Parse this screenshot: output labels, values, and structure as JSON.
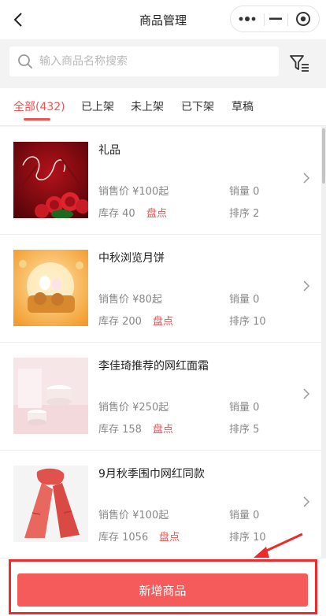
{
  "header": {
    "title": "商品管理"
  },
  "capsule": {
    "more_icon": "more-dots-icon",
    "minimize_icon": "minimize-icon",
    "close_icon": "target-circle-icon"
  },
  "search": {
    "placeholder": "输入商品名称搜索",
    "value": ""
  },
  "tabs": [
    {
      "label": "全部(432)",
      "active": true
    },
    {
      "label": "已上架",
      "active": false
    },
    {
      "label": "未上架",
      "active": false
    },
    {
      "label": "已下架",
      "active": false
    },
    {
      "label": "草稿",
      "active": false
    }
  ],
  "products": [
    {
      "name": "礼品",
      "price": "销售价 ¥100起",
      "stock": "库存 40",
      "action": "盘点",
      "sales": "销量 0",
      "sort": "排序 2"
    },
    {
      "name": "中秋浏览月饼",
      "price": "销售价 ¥80起",
      "stock": "库存 200",
      "action": "盘点",
      "sales": "销量 0",
      "sort": "排序 10"
    },
    {
      "name": "李佳琦推荐的网红面霜",
      "price": "销售价 ¥250起",
      "stock": "库存 158",
      "action": "盘点",
      "sales": "销量 0",
      "sort": "排序 5"
    },
    {
      "name": "9月秋季围巾网红同款",
      "price": "销售价 ¥100起",
      "stock": "库存 1056",
      "action": "盘点",
      "sales": "销量 0",
      "sort": "排序 10"
    }
  ],
  "footer": {
    "add_label": "新增商品"
  },
  "colors": {
    "accent": "#f0504f",
    "button": "#f55b5b",
    "annotation": "#ee2a2a"
  }
}
